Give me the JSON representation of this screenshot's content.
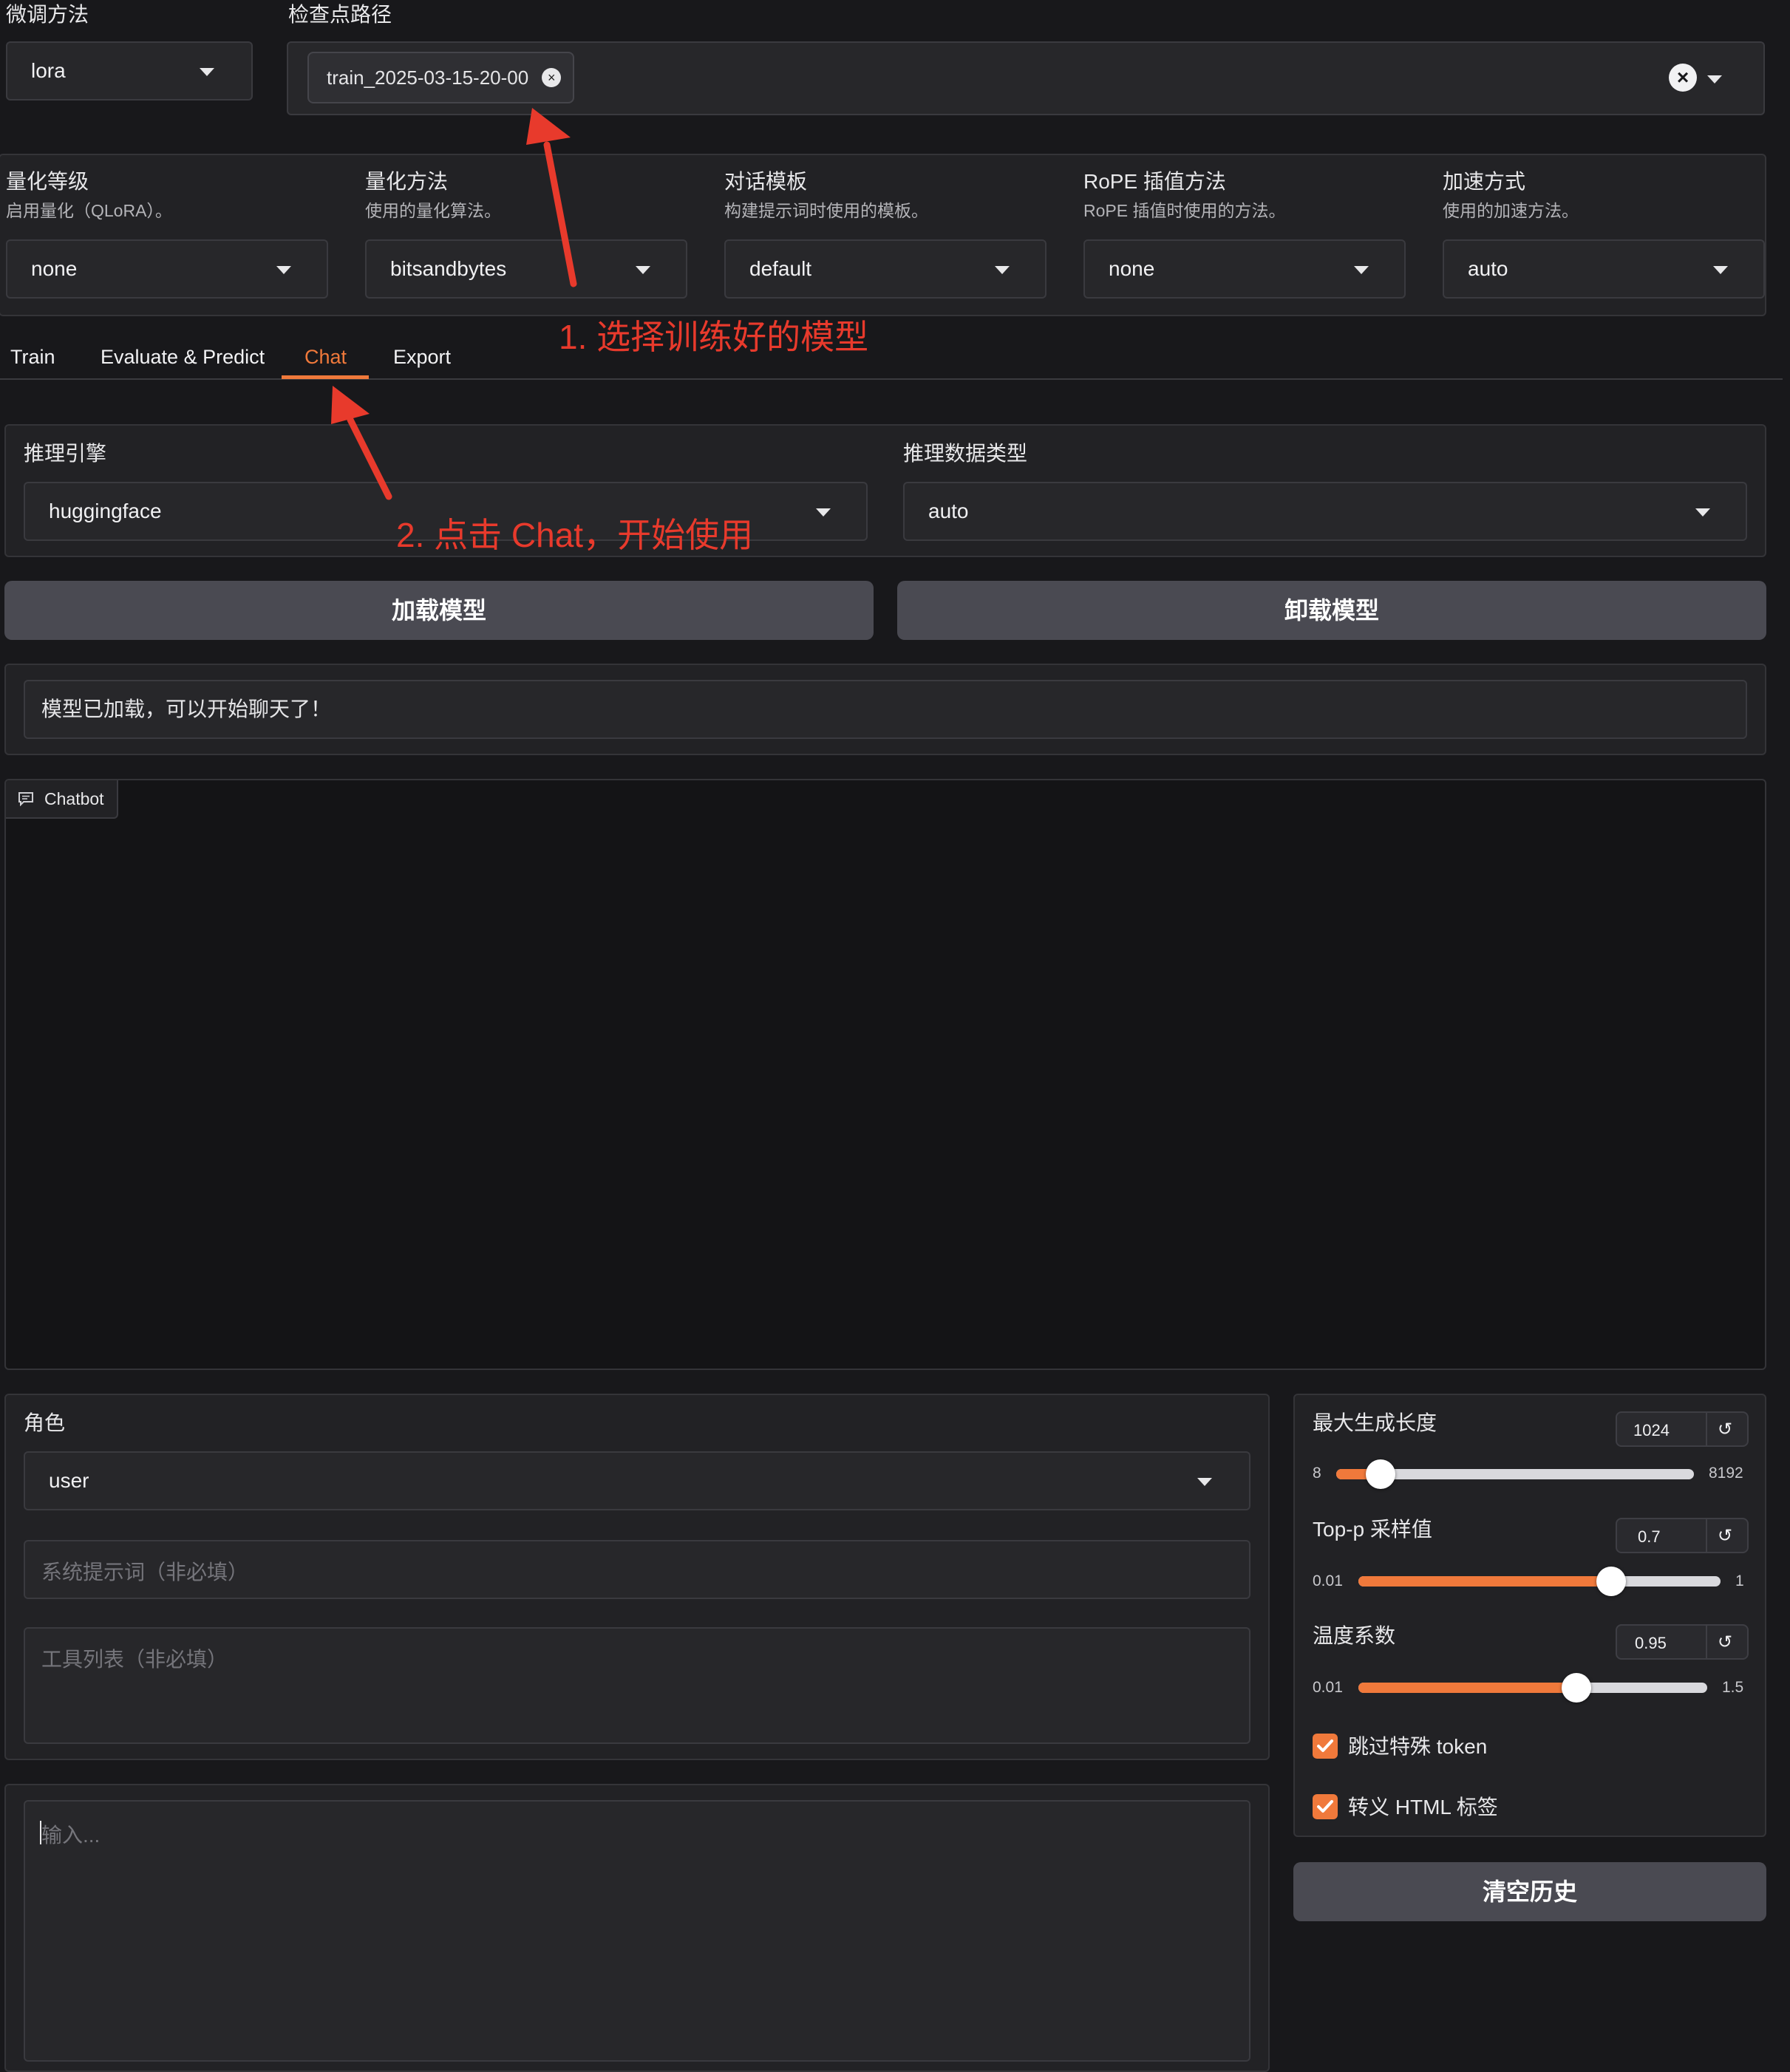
{
  "finetune": {
    "label": "微调方法",
    "value": "lora"
  },
  "checkpoint": {
    "label": "检查点路径",
    "chip": "train_2025-03-15-20-00"
  },
  "options": [
    {
      "label": "量化等级",
      "desc": "启用量化（QLoRA）。",
      "value": "none"
    },
    {
      "label": "量化方法",
      "desc": "使用的量化算法。",
      "value": "bitsandbytes"
    },
    {
      "label": "对话模板",
      "desc": "构建提示词时使用的模板。",
      "value": "default"
    },
    {
      "label": "RoPE 插值方法",
      "desc": "RoPE 插值时使用的方法。",
      "value": "none"
    },
    {
      "label": "加速方式",
      "desc": "使用的加速方法。",
      "value": "auto"
    }
  ],
  "tabs": [
    "Train",
    "Evaluate & Predict",
    "Chat",
    "Export"
  ],
  "active_tab": "Chat",
  "annotations": {
    "step1": "1. 选择训练好的模型",
    "step2": "2. 点击 Chat，开始使用"
  },
  "infer": {
    "backend_label": "推理引擎",
    "backend_value": "huggingface",
    "dtype_label": "推理数据类型",
    "dtype_value": "auto"
  },
  "buttons": {
    "load": "加载模型",
    "unload": "卸载模型",
    "clear": "清空历史"
  },
  "status": "模型已加载，可以开始聊天了！",
  "chatbot_label": "Chatbot",
  "role": {
    "label": "角色",
    "value": "user"
  },
  "system_placeholder": "系统提示词（非必填）",
  "tools_placeholder": "工具列表（非必填）",
  "input_placeholder": "输入...",
  "sliders": [
    {
      "label": "最大生成长度",
      "value": "1024",
      "min": "8",
      "max": "8192",
      "fraction": 0.124
    },
    {
      "label": "Top-p 采样值",
      "value": "0.7",
      "min": "0.01",
      "max": "1",
      "fraction": 0.697
    },
    {
      "label": "温度系数",
      "value": "0.95",
      "min": "0.01",
      "max": "1.5",
      "fraction": 0.624
    }
  ],
  "checkboxes": [
    {
      "label": "跳过特殊 token",
      "checked": true
    },
    {
      "label": "转义 HTML 标签",
      "checked": true
    }
  ],
  "colors": {
    "accent": "#f0793b",
    "annotation": "#e83a2c",
    "background": "#18181b"
  }
}
